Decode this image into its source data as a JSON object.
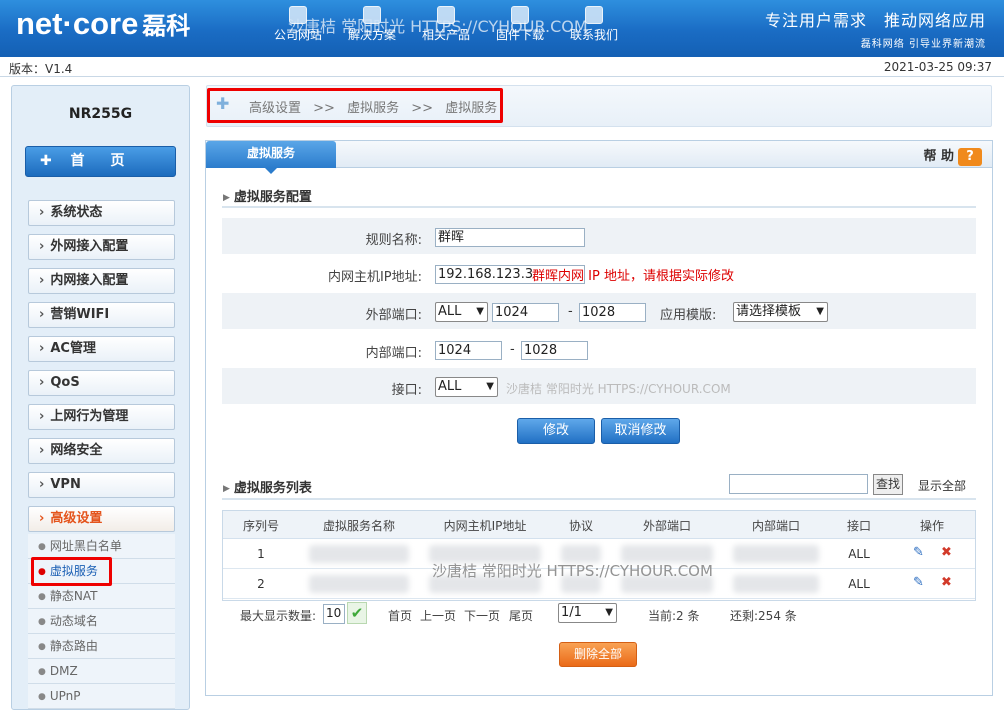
{
  "header": {
    "logo_text": "net·core",
    "logo_cn": "磊科",
    "nav": [
      {
        "label": "公司网站",
        "icon": "home-icon"
      },
      {
        "label": "解决方案",
        "icon": "person-icon"
      },
      {
        "label": "相关产品",
        "icon": "product-icon"
      },
      {
        "label": "固件下载",
        "icon": "download-icon"
      },
      {
        "label": "联系我们",
        "icon": "chat-icon"
      }
    ],
    "slogan_main": "专注用户需求　推动网络应用",
    "slogan_sub": "磊科网络 引导业界新潮流",
    "watermark": "沙唐桔 常阳时光 HTTPS://CYHOUR.COM"
  },
  "info": {
    "version": "版本：V1.4",
    "datetime": "2021-03-25 09:37"
  },
  "sidebar": {
    "model": "NR255G",
    "home_label": "首　页",
    "menu": [
      {
        "label": "系统状态"
      },
      {
        "label": "外网接入配置"
      },
      {
        "label": "内网接入配置"
      },
      {
        "label": "营销WIFI"
      },
      {
        "label": "AC管理"
      },
      {
        "label": "QoS"
      },
      {
        "label": "上网行为管理"
      },
      {
        "label": "网络安全"
      },
      {
        "label": "VPN"
      },
      {
        "label": "高级设置"
      }
    ],
    "submenu": [
      {
        "label": "网址黑白名单"
      },
      {
        "label": "虚拟服务"
      },
      {
        "label": "静态NAT"
      },
      {
        "label": "动态域名"
      },
      {
        "label": "静态路由"
      },
      {
        "label": "DMZ"
      },
      {
        "label": "UPnP"
      }
    ]
  },
  "breadcrumb": {
    "parts": [
      "高级设置",
      ">>",
      "虚拟服务",
      ">>",
      "虚拟服务"
    ]
  },
  "panel": {
    "tab": "虚拟服务",
    "help": "帮 助",
    "help_icon": "?",
    "config_title": "虚拟服务配置",
    "form": {
      "rule_name_label": "规则名称:",
      "rule_name_value": "群晖",
      "host_ip_label": "内网主机IP地址:",
      "host_ip_value": "192.168.123.3",
      "host_ip_hint": "群晖内网 IP 地址，请根据实际修改",
      "ext_port_label": "外部端口:",
      "ext_proto": "ALL",
      "ext_port_start": "1024",
      "dash": "-",
      "ext_port_end": "1028",
      "template_label": "应用模版:",
      "template_value": "请选择模板",
      "int_port_label": "内部端口:",
      "int_port_start": "1024",
      "int_port_end": "1028",
      "iface_label": "接口:",
      "iface_value": "ALL",
      "iface_watermark": "沙唐桔 常阳时光 HTTPS://CYHOUR.COM",
      "modify_btn": "修改",
      "cancel_btn": "取消修改"
    },
    "list_title": "虚拟服务列表",
    "search_btn": "查找",
    "show_all": "显示全部",
    "table": {
      "headers": [
        "序列号",
        "虚拟服务名称",
        "内网主机IP地址",
        "协议",
        "外部端口",
        "内部端口",
        "接口",
        "操作"
      ],
      "rows": [
        {
          "index": "1",
          "iface": "ALL"
        },
        {
          "index": "2",
          "iface": "ALL"
        }
      ],
      "watermark": "沙唐桔 常阳时光 HTTPS://CYHOUR.COM"
    },
    "pager": {
      "max_label": "最大显示数量:",
      "max_value": "10",
      "first": "首页",
      "prev": "上一页",
      "next": "下一页",
      "last": "尾页",
      "page_value": "1/1",
      "current": "当前:2 条",
      "remaining": "还剩:254 条"
    },
    "delete_all": "删除全部"
  }
}
